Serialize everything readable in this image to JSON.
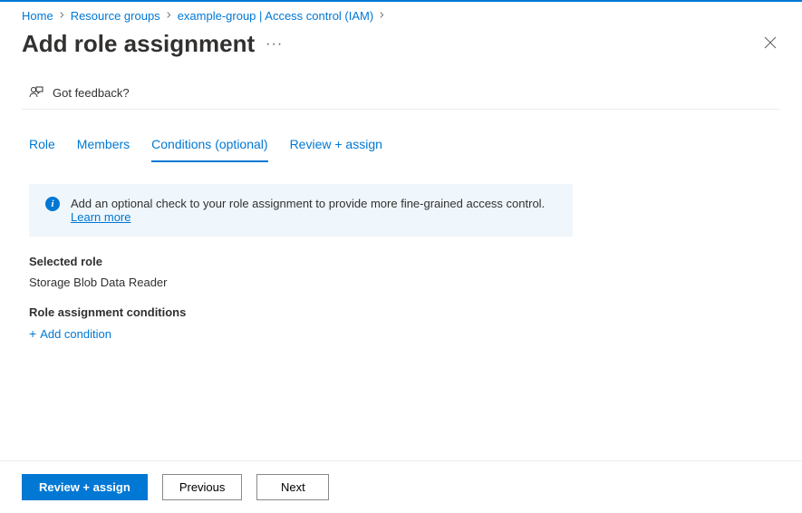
{
  "breadcrumb": {
    "home": "Home",
    "resource_groups": "Resource groups",
    "group_name": "example-group | Access control (IAM)"
  },
  "page_title": "Add role assignment",
  "feedback_label": "Got feedback?",
  "tabs": {
    "role": "Role",
    "members": "Members",
    "conditions": "Conditions (optional)",
    "review": "Review + assign"
  },
  "info": {
    "text": "Add an optional check to your role assignment to provide more fine-grained access control. ",
    "learn_more": "Learn more"
  },
  "selected_role": {
    "label": "Selected role",
    "value": "Storage Blob Data Reader"
  },
  "conditions": {
    "label": "Role assignment conditions",
    "add_label": "Add condition"
  },
  "footer": {
    "review_assign": "Review + assign",
    "previous": "Previous",
    "next": "Next"
  }
}
